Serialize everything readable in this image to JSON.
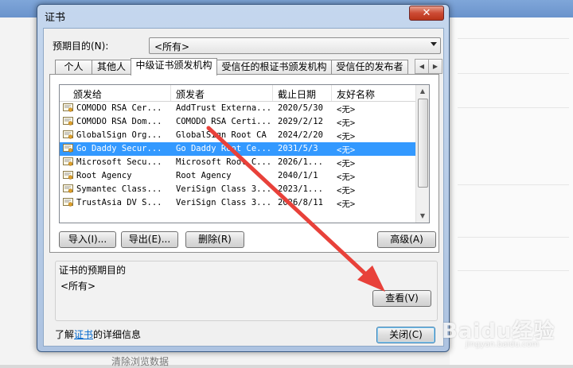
{
  "background": {
    "bottom_text": "清除浏览数据"
  },
  "dialog": {
    "title": "证书",
    "close_icon": "✕",
    "purpose_label": "预期目的(N):",
    "purpose_value": "<所有>",
    "tabs": [
      "个人",
      "其他人",
      "中级证书颁发机构",
      "受信任的根证书颁发机构",
      "受信任的发布者"
    ],
    "active_tab": 2,
    "columns": [
      "颁发给",
      "颁发者",
      "截止日期",
      "友好名称"
    ],
    "rows": [
      {
        "issued_to": "COMODO RSA Cer...",
        "issued_by": "AddTrust Externa...",
        "expires": "2020/5/30",
        "friendly": "<无>",
        "selected": false
      },
      {
        "issued_to": "COMODO RSA Dom...",
        "issued_by": "COMODO RSA Certi...",
        "expires": "2029/2/12",
        "friendly": "<无>",
        "selected": false
      },
      {
        "issued_to": "GlobalSign Org...",
        "issued_by": "GlobalSign Root CA",
        "expires": "2024/2/20",
        "friendly": "<无>",
        "selected": false
      },
      {
        "issued_to": "Go Daddy Secur...",
        "issued_by": "Go Daddy Root Ce...",
        "expires": "2031/5/3",
        "friendly": "<无>",
        "selected": true
      },
      {
        "issued_to": "Microsoft Secu...",
        "issued_by": "Microsoft Root C...",
        "expires": "2026/1...",
        "friendly": "<无>",
        "selected": false
      },
      {
        "issued_to": "Root Agency",
        "issued_by": "Root Agency",
        "expires": "2040/1/1",
        "friendly": "<无>",
        "selected": false
      },
      {
        "issued_to": "Symantec Class...",
        "issued_by": "VeriSign Class 3...",
        "expires": "2023/1...",
        "friendly": "<无>",
        "selected": false
      },
      {
        "issued_to": "TrustAsia DV S...",
        "issued_by": "VeriSign Class 3...",
        "expires": "2026/8/11",
        "friendly": "<无>",
        "selected": false
      }
    ],
    "buttons": {
      "import": "导入(I)...",
      "export": "导出(E)...",
      "remove": "删除(R)",
      "advanced": "高级(A)",
      "view": "查看(V)",
      "close": "关闭(C)"
    },
    "group_title": "证书的预期目的",
    "group_value": "<所有>",
    "learn_prefix": "了解",
    "learn_link": "证书",
    "learn_suffix": "的详细信息"
  },
  "watermark": {
    "logo": "Baidu经验",
    "url": "jingyan.baidu.com"
  },
  "colors": {
    "selection": "#3399ff",
    "annotation_arrow": "#e8413a",
    "link": "#0066cc"
  }
}
